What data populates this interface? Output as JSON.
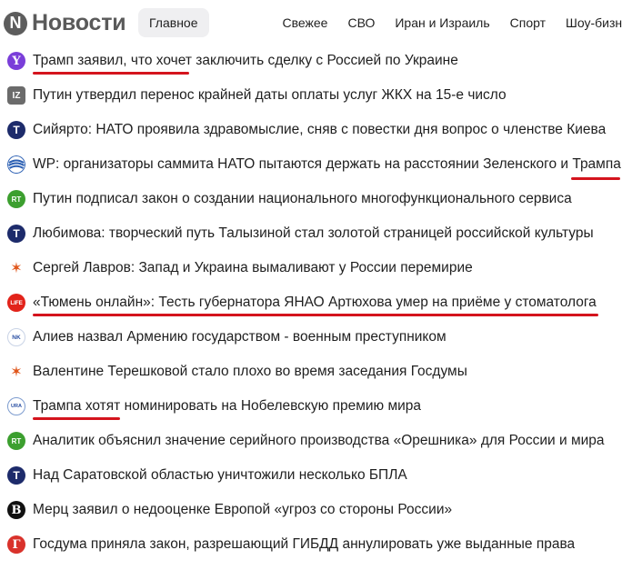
{
  "header": {
    "logo_mark": "N",
    "logo_text": "Новости",
    "tabs": [
      {
        "label": "Главное",
        "active": true
      },
      {
        "label": "Свежее"
      },
      {
        "label": "СВО"
      },
      {
        "label": "Иран и Израиль"
      },
      {
        "label": "Спорт"
      },
      {
        "label": "Шоу-бизнес"
      }
    ]
  },
  "news": [
    {
      "source_icon": "yandex-icon",
      "icon_text": "Y",
      "headline": "Трамп заявил, что хочет заключить сделку с Россией по Украине"
    },
    {
      "source_icon": "iz-icon",
      "icon_text": "IZ",
      "headline": "Путин утвердил перенос крайней даты оплаты услуг ЖКХ на 15-е число"
    },
    {
      "source_icon": "tass-icon",
      "icon_text": "T",
      "headline": "Сийярто: НАТО проявила здравомыслие, сняв с повестки дня вопрос о членстве Киева"
    },
    {
      "source_icon": "wp-globe-icon",
      "icon_text": "",
      "headline": "WP: организаторы саммита НАТО пытаются держать на расстоянии Зеленского и Трампа"
    },
    {
      "source_icon": "rt-icon",
      "icon_text": "RT",
      "headline": "Путин подписал закон о создании национального многофункционального сервиса"
    },
    {
      "source_icon": "tass-icon",
      "icon_text": "T",
      "headline": "Любимова: творческий путь Талызиной стал золотой страницей российской культуры"
    },
    {
      "source_icon": "star-icon",
      "icon_text": "✶",
      "headline": "Сергей Лавров: Запад и Украина вымаливают у России перемирие"
    },
    {
      "source_icon": "life-icon",
      "icon_text": "LIFE",
      "headline": "«Тюмень онлайн»: Тесть губернатора ЯНАО Артюхова умер на приёме у стоматолога"
    },
    {
      "source_icon": "nk-icon",
      "icon_text": "NK",
      "headline": "Алиев назвал Армению государством - военным преступником"
    },
    {
      "source_icon": "star-icon",
      "icon_text": "✶",
      "headline": "Валентине Терешковой стало плохо во время заседания Госдумы"
    },
    {
      "source_icon": "ura-icon",
      "icon_text": "URA",
      "headline": "Трампа хотят номинировать на Нобелевскую премию мира"
    },
    {
      "source_icon": "rt-icon",
      "icon_text": "RT",
      "headline": "Аналитик объяснил значение серийного производства «Орешника» для России и мира"
    },
    {
      "source_icon": "tass-icon",
      "icon_text": "T",
      "headline": "Над Саратовской областью уничтожили несколько БПЛА"
    },
    {
      "source_icon": "b-icon",
      "icon_text": "B",
      "headline": "Мерц заявил о недооценке Европой «угроз со стороны России»"
    },
    {
      "source_icon": "g-icon",
      "icon_text": "Г",
      "headline": "Госдума приняла закон, разрешающий ГИБДД аннулировать уже выданные права"
    }
  ],
  "colors": {
    "underline": "#d4141d",
    "active_tab_bg": "#efeff1",
    "text": "#1f1f1f"
  }
}
